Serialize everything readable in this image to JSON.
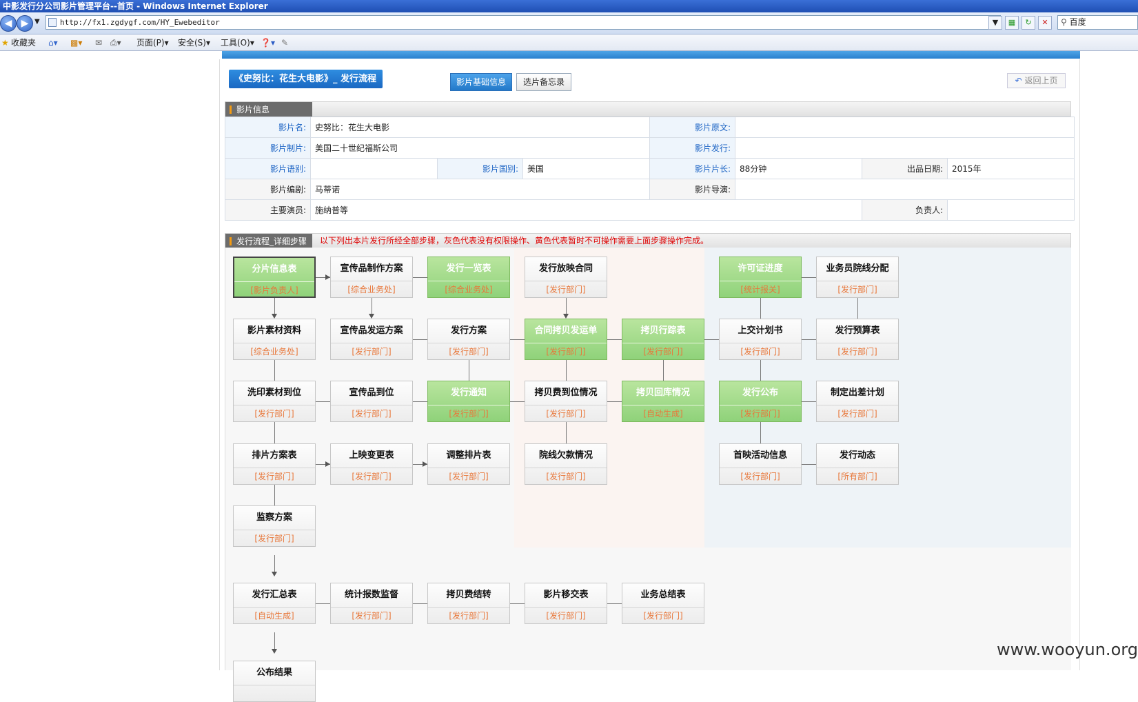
{
  "browser": {
    "title": "中影发行分公司影片管理平台--首页 - Windows Internet Explorer",
    "url": "http://fx1.zgdygf.com/HY_Ewebeditor",
    "search_placeholder": "百度",
    "favorites": "收藏夹",
    "menu_page": "页面(P)",
    "menu_safety": "安全(S)",
    "menu_tools": "工具(O)"
  },
  "header": {
    "breadcrumb": "《史努比：花生大电影》_ 发行流程",
    "tabs": [
      "影片基础信息",
      "选片备忘录"
    ],
    "back": "返回上页"
  },
  "film_info": {
    "section_title": "影片信息",
    "name_label": "影片名:",
    "name": "史努比：花生大电影",
    "original_label": "影片原文:",
    "original": "",
    "producer_label": "影片制片:",
    "producer": "美国二十世纪福斯公司",
    "distributor_label": "影片发行:",
    "distributor": "",
    "language_label": "影片语别:",
    "language": "",
    "country_label": "影片国别:",
    "country": "美国",
    "length_label": "影片片长:",
    "length": "88分钟",
    "date_label": "出品日期:",
    "date": "2015年",
    "writer_label": "影片编剧:",
    "writer": "马蒂诺",
    "director_label": "影片导演:",
    "director": "",
    "actors_label": "主要演员:",
    "actors": "施纳普等",
    "owner_label": "负责人:",
    "owner": ""
  },
  "flow": {
    "section_title": "发行流程_详细步骤",
    "tip": "以下列出本片发行所经全部步骤，灰色代表没有权限操作、黄色代表暂时不可操作需要上面步骤操作完成。",
    "nodes": [
      {
        "title": "分片信息表",
        "dept": "[影片负责人]",
        "state": "green-selected"
      },
      {
        "title": "宣传品制作方案",
        "dept": "[综合业务处]",
        "state": "gray"
      },
      {
        "title": "发行一览表",
        "dept": "[综合业务处]",
        "state": "green"
      },
      {
        "title": "发行放映合同",
        "dept": "[发行部门]",
        "state": "gray"
      },
      {
        "title": "许可证进度",
        "dept": "[统计报关]",
        "state": "green"
      },
      {
        "title": "业务员院线分配",
        "dept": "[发行部门]",
        "state": "gray"
      },
      {
        "title": "影片素材资料",
        "dept": "[综合业务处]",
        "state": "gray"
      },
      {
        "title": "宣传品发运方案",
        "dept": "[发行部门]",
        "state": "gray"
      },
      {
        "title": "发行方案",
        "dept": "[发行部门]",
        "state": "gray"
      },
      {
        "title": "合同拷贝发运单",
        "dept": "[发行部门]",
        "state": "green"
      },
      {
        "title": "拷贝行踪表",
        "dept": "[发行部门]",
        "state": "green"
      },
      {
        "title": "上交计划书",
        "dept": "[发行部门]",
        "state": "gray"
      },
      {
        "title": "发行预算表",
        "dept": "[发行部门]",
        "state": "gray"
      },
      {
        "title": "洗印素材到位",
        "dept": "[发行部门]",
        "state": "gray"
      },
      {
        "title": "宣传品到位",
        "dept": "[发行部门]",
        "state": "gray"
      },
      {
        "title": "发行通知",
        "dept": "[发行部门]",
        "state": "green"
      },
      {
        "title": "拷贝费到位情况",
        "dept": "[发行部门]",
        "state": "gray"
      },
      {
        "title": "拷贝回库情况",
        "dept": "[自动生成]",
        "state": "green"
      },
      {
        "title": "发行公布",
        "dept": "[发行部门]",
        "state": "green"
      },
      {
        "title": "制定出差计划",
        "dept": "[发行部门]",
        "state": "gray"
      },
      {
        "title": "排片方案表",
        "dept": "[发行部门]",
        "state": "gray"
      },
      {
        "title": "上映变更表",
        "dept": "[发行部门]",
        "state": "gray"
      },
      {
        "title": "调整排片表",
        "dept": "[发行部门]",
        "state": "gray"
      },
      {
        "title": "院线欠款情况",
        "dept": "[发行部门]",
        "state": "gray"
      },
      {
        "title": "首映活动信息",
        "dept": "[发行部门]",
        "state": "gray"
      },
      {
        "title": "发行动态",
        "dept": "[所有部门]",
        "state": "gray"
      },
      {
        "title": "监察方案",
        "dept": "[发行部门]",
        "state": "gray"
      },
      {
        "title": "发行汇总表",
        "dept": "[自动生成]",
        "state": "gray"
      },
      {
        "title": "统计报数监督",
        "dept": "[发行部门]",
        "state": "gray"
      },
      {
        "title": "拷贝费结转",
        "dept": "[发行部门]",
        "state": "gray"
      },
      {
        "title": "影片移交表",
        "dept": "[发行部门]",
        "state": "gray"
      },
      {
        "title": "业务总结表",
        "dept": "[发行部门]",
        "state": "gray"
      },
      {
        "title": "公布结果",
        "dept": "",
        "state": "gray"
      }
    ]
  },
  "watermark": "www.wooyun.org",
  "colors": {
    "accent": "#2379c9",
    "green": "#8fd27a",
    "dept": "#e8773a",
    "tip": "#dd0000"
  }
}
